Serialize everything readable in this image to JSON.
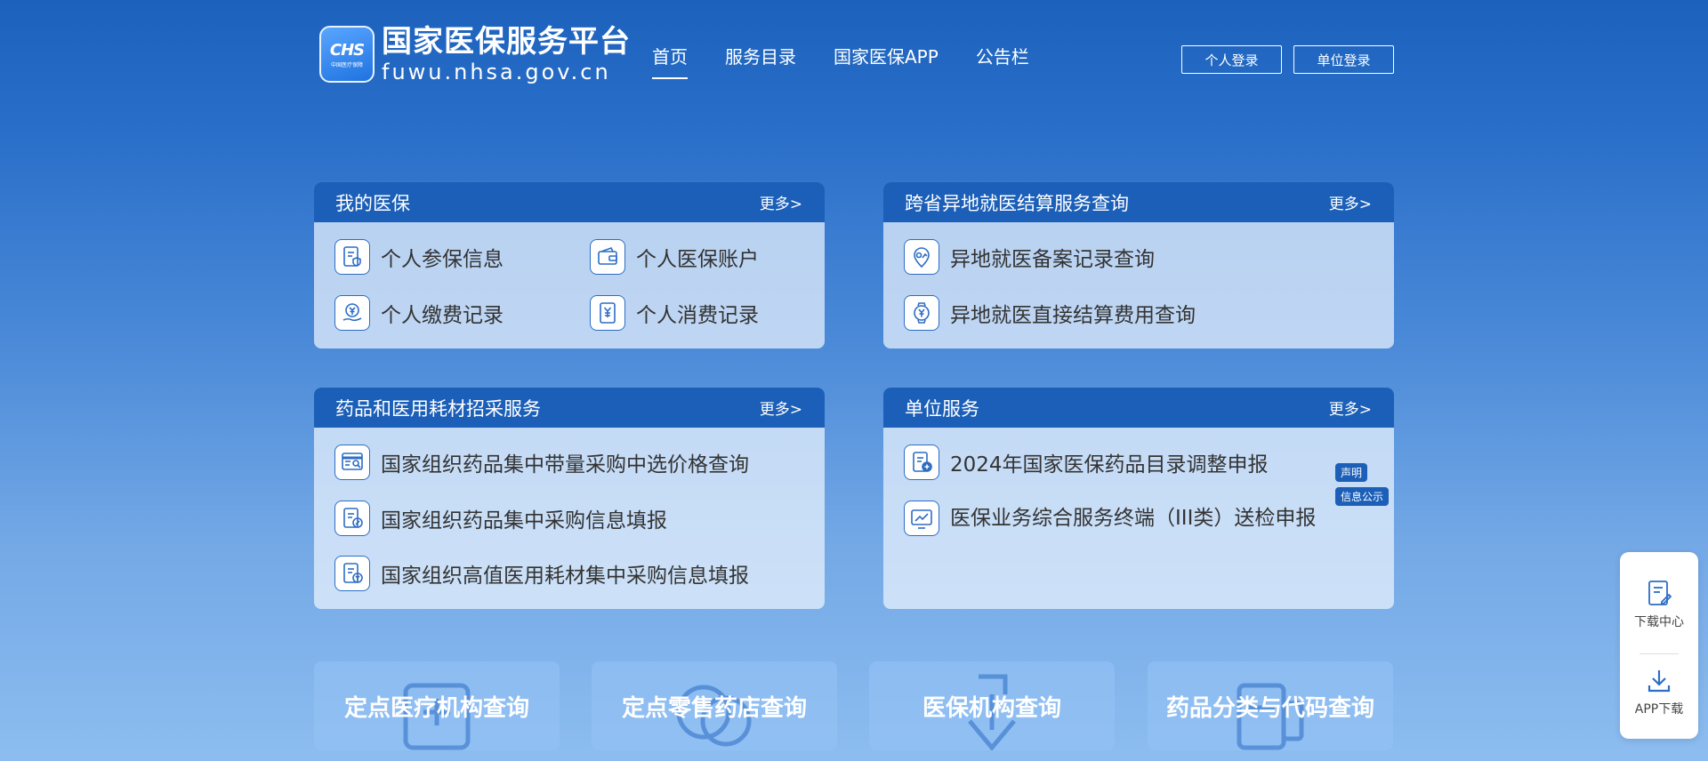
{
  "header": {
    "logo_badge": "CHS",
    "logo_badge_sub": "中国医疗保障",
    "logo_title": "国家医保服务平台",
    "logo_url": "fuwu.nhsa.gov.cn",
    "nav": [
      "首页",
      "服务目录",
      "国家医保APP",
      "公告栏"
    ],
    "login_personal": "个人登录",
    "login_unit": "单位登录"
  },
  "panels": {
    "my_insurance": {
      "title": "我的医保",
      "more": "更多>",
      "items": [
        "个人参保信息",
        "个人医保账户",
        "个人缴费记录",
        "个人消费记录"
      ]
    },
    "cross_province": {
      "title": "跨省异地就医结算服务查询",
      "more": "更多>",
      "items": [
        "异地就医备案记录查询",
        "异地就医直接结算费用查询"
      ]
    },
    "procurement": {
      "title": "药品和医用耗材招采服务",
      "more": "更多>",
      "items": [
        "国家组织药品集中带量采购中选价格查询",
        "国家组织药品集中采购信息填报",
        "国家组织高值医用耗材集中采购信息填报"
      ]
    },
    "unit_service": {
      "title": "单位服务",
      "more": "更多>",
      "items": [
        "2024年国家医保药品目录调整申报",
        "医保业务综合服务终端（III类）送检申报"
      ],
      "tags": [
        "声明",
        "信息公示"
      ]
    }
  },
  "cards": [
    "定点医疗机构查询",
    "定点零售药店查询",
    "医保机构查询",
    "药品分类与代码查询"
  ],
  "side": {
    "download_center": "下载中心",
    "app_download": "APP下载"
  },
  "colors": {
    "primary": "#1b5fb8",
    "bg_top": "#1c62bd",
    "bg_bottom": "#8dbdf0"
  }
}
